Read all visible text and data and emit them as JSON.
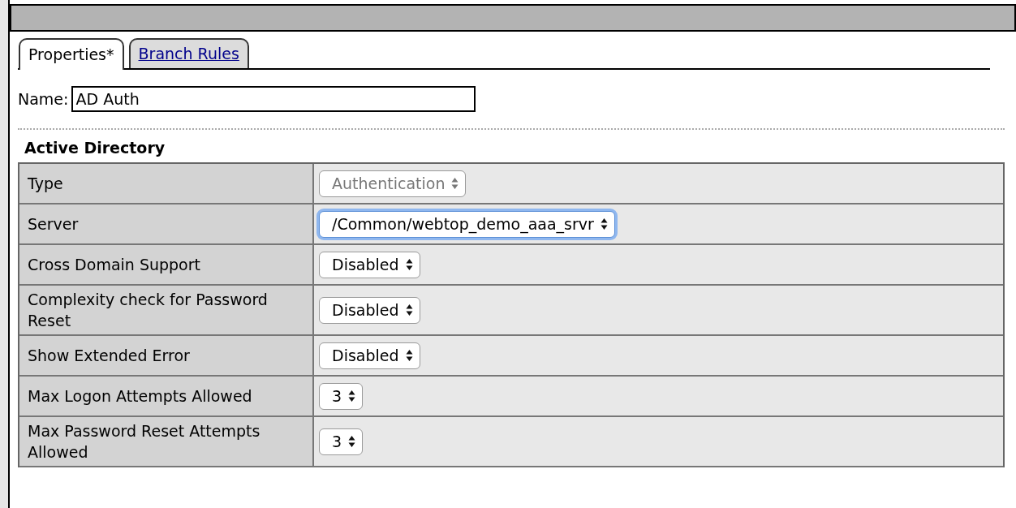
{
  "tabs": [
    {
      "label": "Properties*",
      "selected": true
    },
    {
      "label": "Branch Rules",
      "selected": false
    }
  ],
  "name_field": {
    "label": "Name:",
    "value": "AD Auth"
  },
  "section_title": "Active Directory",
  "rows": [
    {
      "label": "Type",
      "value": "Authentication",
      "disabled": true,
      "focused": false
    },
    {
      "label": "Server",
      "value": "/Common/webtop_demo_aaa_srvr",
      "disabled": false,
      "focused": true
    },
    {
      "label": "Cross Domain Support",
      "value": "Disabled",
      "disabled": false,
      "focused": false
    },
    {
      "label": "Complexity check for Password Reset",
      "value": "Disabled",
      "disabled": false,
      "focused": false
    },
    {
      "label": "Show Extended Error",
      "value": "Disabled",
      "disabled": false,
      "focused": false
    },
    {
      "label": "Max Logon Attempts Allowed",
      "value": "3",
      "disabled": false,
      "focused": false
    },
    {
      "label": "Max Password Reset Attempts Allowed",
      "value": "3",
      "disabled": false,
      "focused": false
    }
  ]
}
